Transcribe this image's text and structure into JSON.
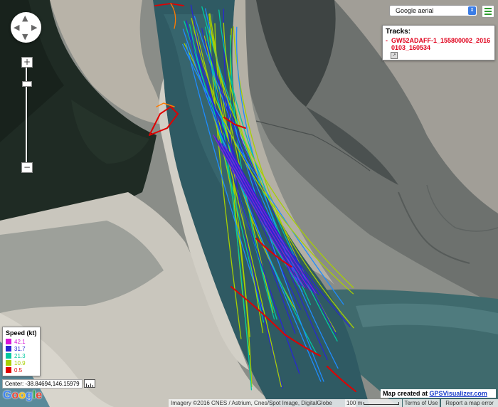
{
  "map_type": {
    "selected": "Google aerial"
  },
  "tracks_panel": {
    "title": "Tracks:",
    "dash": "-",
    "track_name": "GW52ADAFF-1_155800002_20160103_160534"
  },
  "legend": {
    "title": "Speed (kt)",
    "rows": [
      {
        "label": "42.1",
        "color": "#d814d8"
      },
      {
        "label": "31.7",
        "color": "#2828d0"
      },
      {
        "label": "21.3",
        "color": "#00c8a0"
      },
      {
        "label": "10.9",
        "color": "#a8d000"
      },
      {
        "label": "0.5",
        "color": "#e00000"
      }
    ]
  },
  "center_readout": "Center: -38.84694,146.15979",
  "google_logo": {
    "letters": [
      "G",
      "o",
      "o",
      "g",
      "l",
      "e"
    ],
    "colors": [
      "#4285f4",
      "#ea4335",
      "#fbbc05",
      "#4285f4",
      "#34a853",
      "#ea4335"
    ]
  },
  "created_by": {
    "prefix": "Map created at",
    "link": "GPSVisualizer.com"
  },
  "attribution": "Imagery ©2016 CNES / Astrium, Cnes/Spot Image, DigitalGlobe",
  "scale_label": "100 m",
  "terms_label": "Terms of Use",
  "report_label": "Report a map error",
  "controls": {
    "zoom_in": "+",
    "zoom_out": "−",
    "pan_up": "▲",
    "pan_down": "▼",
    "pan_left": "◀",
    "pan_right": "▶"
  },
  "track_colors": [
    "#e00000",
    "#ff7a00",
    "#a8d000",
    "#00c8a0",
    "#1e8cff",
    "#2828d0",
    "#7a1ee0"
  ]
}
